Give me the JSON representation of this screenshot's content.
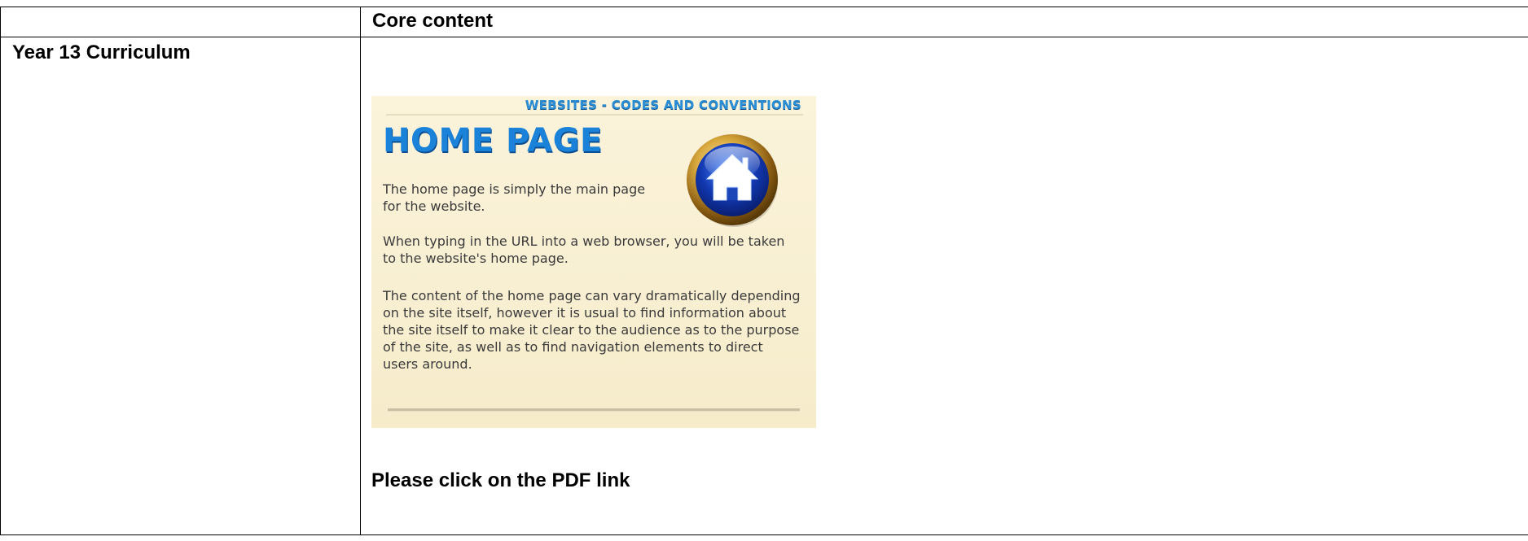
{
  "table": {
    "header_col1": "",
    "header_col2": "Core content",
    "row_label": "Year 13 Curriculum"
  },
  "slide": {
    "header": "WEBSITES - CODES AND CONVENTIONS",
    "title": "HOME PAGE",
    "para1": "The home page is simply the main page for the website.",
    "para2": "When typing in the URL into a web browser, you will be taken to the website's home page.",
    "para3": "The content of the home page can vary dramatically depending on the site itself, however it is usual to find information about the site itself to make it clear to the audience as to the purpose of the site, as well as to find navigation elements to direct users around.",
    "icon": "home-icon",
    "colors": {
      "background": "#f8efd2",
      "title_blue": "#1a82d8",
      "badge_gold": "#c9962a",
      "badge_blue": "#0b3fa8"
    }
  },
  "note": "Please click on the PDF link"
}
